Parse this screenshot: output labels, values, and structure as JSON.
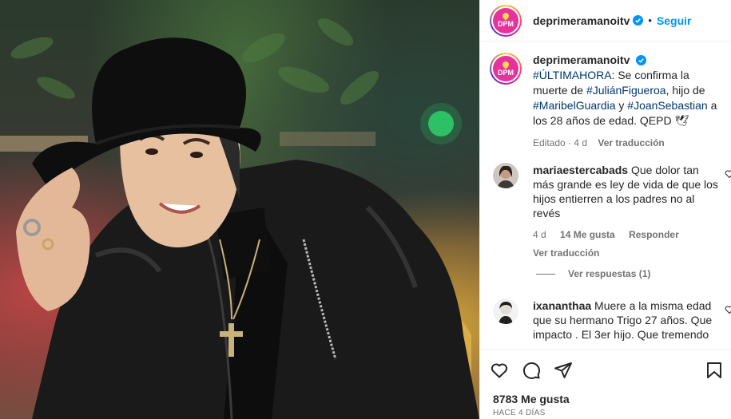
{
  "post": {
    "username": "deprimeramanoitv",
    "avatar_text": "DPM",
    "follow_label": "Seguir",
    "separator": "•",
    "likes": "8783 Me gusta",
    "time": "HACE 4 DÍAS"
  },
  "caption": {
    "username": "deprimeramanoitv",
    "tag1": "#ÚLTIMAHORA",
    "text1": ": Se confirma la muerte de ",
    "tag2": "#JuliánFigueroa",
    "text2": ", hijo de ",
    "tag3": "#MaribelGuardia",
    "text3": " y ",
    "tag4": "#JoanSebastian",
    "text4": " a los 28 años de edad. QEPD 🕊",
    "edited": "Editado · 4 d",
    "translate": "Ver traducción"
  },
  "comments": [
    {
      "username": "mariaestercabads",
      "text": " Que dolor tan más grande es ley de vida de que los hijos entierren a los padres no al revés",
      "date": "4 d",
      "likes": "14 Me gusta",
      "reply": "Responder",
      "translate": "Ver traducción",
      "view_replies": "Ver respuestas (1)"
    },
    {
      "username": "ixananthaa",
      "text": " Muere a la misma edad que su hermano Trigo 27 años. Que impacto . El 3er hijo. Que tremendo"
    }
  ],
  "colors": {
    "link": "#0095f6",
    "hashtag": "#00376b",
    "muted": "#737373",
    "verified": "#0095f6"
  },
  "icons": [
    "verified-icon",
    "heart-icon",
    "comment-icon",
    "share-icon",
    "save-icon"
  ]
}
